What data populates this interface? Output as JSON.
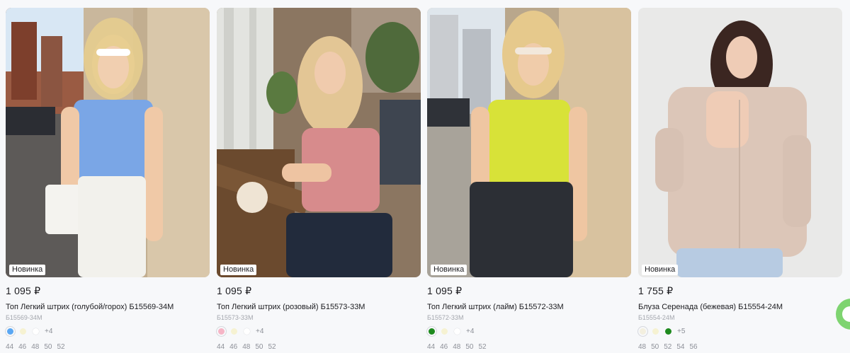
{
  "products": [
    {
      "badge": "Новинка",
      "price": "1 095 ₽",
      "title": "Топ Легкий штрих (голубой/горох) Б15569-34М",
      "sku": "Б15569-34М",
      "photo_icon": "woman-blue-top-photo",
      "colors": [
        "#5aa7f3",
        "#f6f2d2",
        "#ffffff"
      ],
      "more_colors": "+4",
      "sizes": [
        "44",
        "46",
        "48",
        "50",
        "52"
      ]
    },
    {
      "badge": "Новинка",
      "price": "1 095 ₽",
      "title": "Топ Легкий штрих (розовый) Б15573-33М",
      "sku": "Б15573-33М",
      "photo_icon": "woman-pink-top-photo",
      "colors": [
        "#f6b5c6",
        "#f6f2d2",
        "#ffffff"
      ],
      "more_colors": "+4",
      "sizes": [
        "44",
        "46",
        "48",
        "50",
        "52"
      ]
    },
    {
      "badge": "Новинка",
      "price": "1 095 ₽",
      "title": "Топ Легкий штрих (лайм) Б15572-33М",
      "sku": "Б15572-33М",
      "photo_icon": "woman-lime-top-photo",
      "colors": [
        "#1e8a1e",
        "#f6f2d2",
        "#ffffff"
      ],
      "more_colors": "+4",
      "sizes": [
        "44",
        "46",
        "48",
        "50",
        "52"
      ]
    },
    {
      "badge": "Новинка",
      "price": "1 755 ₽",
      "title": "Блуза Серенада (бежевая) Б15554-24М",
      "sku": "Б15554-24М",
      "photo_icon": "woman-beige-blouse-photo",
      "colors": [
        "#f3efdf",
        "#f6f2d2",
        "#1e8a1e"
      ],
      "more_colors": "+5",
      "sizes": [
        "48",
        "50",
        "52",
        "54",
        "56"
      ]
    }
  ],
  "chat_icon": "chat-bubble-icon"
}
